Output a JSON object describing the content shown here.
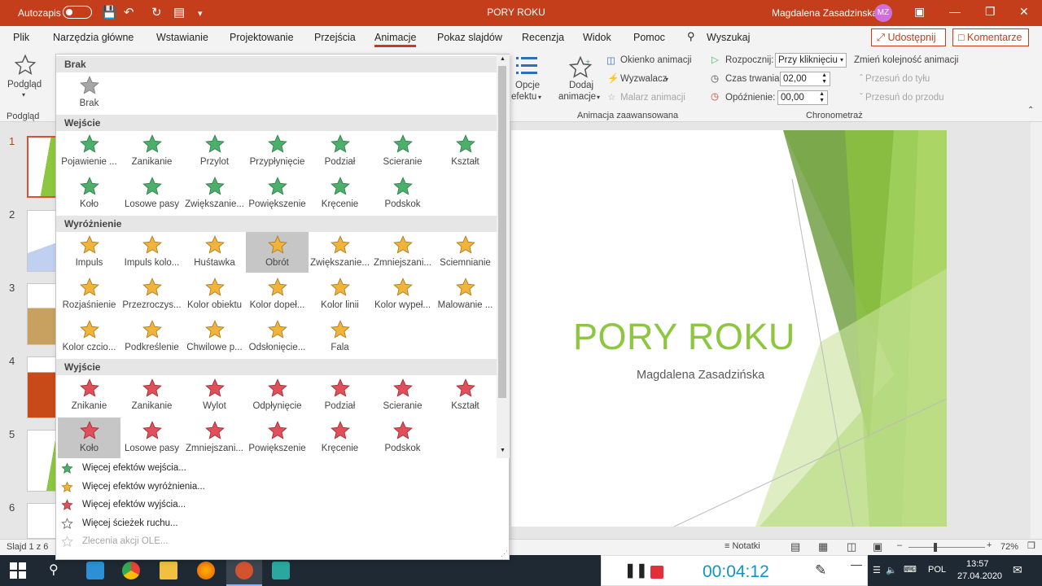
{
  "title_bar": {
    "autosave": "Autozapis",
    "doc_title": "PORY ROKU",
    "user_name": "Magdalena Zasadzinska",
    "user_initials": "MZ"
  },
  "menu": {
    "tabs": [
      "Plik",
      "Narzędzia główne",
      "Wstawianie",
      "Projektowanie",
      "Przejścia",
      "Animacje",
      "Pokaz slajdów",
      "Recenzja",
      "Widok",
      "Pomoc"
    ],
    "search": "Wyszukaj",
    "share": "Udostępnij",
    "comments": "Komentarze"
  },
  "ribbon": {
    "preview": "Podgląd",
    "preview_group": "Podgląd",
    "effect_options": [
      "Opcje",
      "efektu"
    ],
    "add_animation": [
      "Dodaj",
      "animacje"
    ],
    "animation_pane": "Okienko animacji",
    "trigger": "Wyzwalacz",
    "painter": "Malarz animacji",
    "advanced_group": "Animacja zaawansowana",
    "start_label": "Rozpocznij:",
    "start_value": "Przy kliknięciu",
    "duration_label": "Czas trwania:",
    "duration_value": "02,00",
    "delay_label": "Opóźnienie:",
    "delay_value": "00,00",
    "reorder": "Zmień kolejność animacji",
    "move_earlier": "Przesuń do tyłu",
    "move_later": "Przesuń do przodu",
    "timing_group": "Chronometraż"
  },
  "gallery": {
    "none_header": "Brak",
    "none_items": [
      "Brak"
    ],
    "entrance_header": "Wejście",
    "entrance": [
      "Pojawienie ...",
      "Zanikanie",
      "Przylot",
      "Przypłynięcie",
      "Podział",
      "Ścieranie",
      "Kształt",
      "Koło",
      "Losowe pasy",
      "Zwiększanie...",
      "Powiększenie",
      "Kręcenie",
      "Podskok"
    ],
    "emphasis_header": "Wyróżnienie",
    "emphasis": [
      "Impuls",
      "Impuls kolo...",
      "Huśtawka",
      "Obrót",
      "Zwiększanie...",
      "Zmniejszani...",
      "Ściemnianie",
      "Rozjaśnienie",
      "Przezroczys...",
      "Kolor obiektu",
      "Kolor dopeł...",
      "Kolor linii",
      "Kolor wypeł...",
      "Malowanie ...",
      "Kolor czcio...",
      "Podkreślenie",
      "Chwilowe p...",
      "Odsłonięcie...",
      "Fala"
    ],
    "exit_header": "Wyjście",
    "exit": [
      "Znikanie",
      "Zanikanie",
      "Wylot",
      "Odpłynięcie",
      "Podział",
      "Ścieranie",
      "Kształt",
      "Koło",
      "Losowe pasy",
      "Zmniejszani...",
      "Powiększenie",
      "Kręcenie",
      "Podskok"
    ],
    "more": [
      "Więcej efektów wejścia...",
      "Więcej efektów wyróżnienia...",
      "Więcej efektów wyjścia...",
      "Więcej ścieżek ruchu...",
      "Zlecenia akcji OLE..."
    ]
  },
  "slides": {
    "numbers": [
      "1",
      "2",
      "3",
      "4",
      "5",
      "6"
    ],
    "selected": "1"
  },
  "slide": {
    "title": "PORY ROKU",
    "subtitle": "Magdalena Zasadzińska"
  },
  "status": {
    "slide_info": "Slajd 1 z 6",
    "notes": "Notatki",
    "zoom": "72%"
  },
  "recorder": {
    "time": "00:04:12"
  },
  "taskbar": {
    "language": "POL",
    "time": "13:57",
    "date": "27.04.2020"
  },
  "colors": {
    "accent": "#c43e1c",
    "entrance": "#4caf6a",
    "emphasis": "#f0b43c",
    "exit": "#e0505a",
    "slide_green": "#8dc63f"
  }
}
